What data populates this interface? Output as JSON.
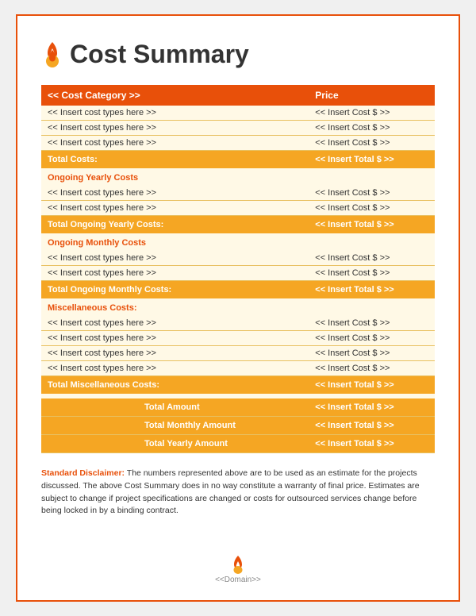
{
  "header": {
    "title": "Cost Summary",
    "icon_alt": "flame"
  },
  "table": {
    "header": {
      "col1": "<< Cost Category >>",
      "col2": "Price"
    },
    "sections": [
      {
        "items": [
          {
            "label": "<< Insert cost types here >>",
            "price": "<< Insert Cost $ >>"
          },
          {
            "label": "<< Insert cost types here >>",
            "price": "<< Insert Cost $ >>"
          },
          {
            "label": "<< Insert cost types here >>",
            "price": "<< Insert Cost $ >>"
          }
        ],
        "total_label": "Total Costs:",
        "total_price": "<< Insert Total $ >>"
      },
      {
        "section_name": "Ongoing Yearly Costs",
        "items": [
          {
            "label": "<< Insert cost types here >>",
            "price": "<< Insert Cost $ >>"
          },
          {
            "label": "<< Insert cost types here >>",
            "price": "<< Insert Cost $ >>"
          }
        ],
        "total_label": "Total Ongoing Yearly Costs:",
        "total_price": "<< Insert Total $ >>"
      },
      {
        "section_name": "Ongoing Monthly Costs",
        "items": [
          {
            "label": "<< Insert cost types here >>",
            "price": "<< Insert Cost $ >>"
          },
          {
            "label": "<< Insert cost types here >>",
            "price": "<< Insert Cost $ >>"
          }
        ],
        "total_label": "Total Ongoing Monthly Costs:",
        "total_price": "<< Insert Total $ >>"
      },
      {
        "section_name": "Miscellaneous Costs:",
        "items": [
          {
            "label": "<< Insert cost types here >>",
            "price": "<< Insert Cost $ >>"
          },
          {
            "label": "<< Insert cost types here >>",
            "price": "<< Insert Cost $ >>"
          },
          {
            "label": "<< Insert cost types here >>",
            "price": "<< Insert Cost $ >>"
          },
          {
            "label": "<< Insert cost types here >>",
            "price": "<< Insert Cost $ >>"
          }
        ],
        "total_label": "Total Miscellaneous Costs:",
        "total_price": "<< Insert Total $ >>"
      }
    ],
    "summary": [
      {
        "label": "Total Amount",
        "price": "<< Insert Total $ >>"
      },
      {
        "label": "Total Monthly Amount",
        "price": "<< Insert Total $ >>"
      },
      {
        "label": "Total Yearly Amount",
        "price": "<< Insert Total $ >>"
      }
    ]
  },
  "disclaimer": {
    "bold": "Standard Disclaimer:",
    "text": " The numbers represented above are to be used as an estimate for the projects discussed. The above Cost Summary does in no way constitute a warranty of final price.  Estimates are subject to change if project specifications are changed or costs for outsourced services change before being locked in by a binding contract."
  },
  "footer": {
    "domain": "<<Domain>>"
  }
}
